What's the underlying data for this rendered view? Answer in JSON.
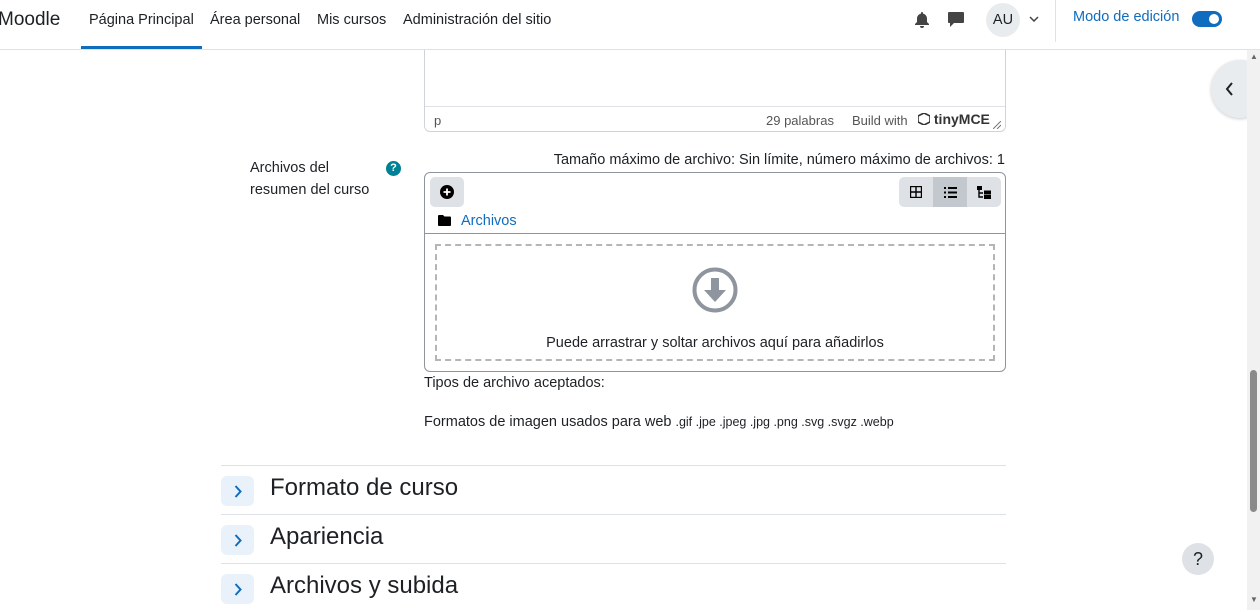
{
  "navbar": {
    "brand": "Moodle",
    "items": [
      {
        "label": "Página Principal",
        "active": true
      },
      {
        "label": "Área personal"
      },
      {
        "label": "Mis cursos"
      },
      {
        "label": "Administración del sitio"
      }
    ],
    "user_initials": "AU",
    "edit_mode_label": "Modo de edición",
    "edit_mode_on": true,
    "accent_color": "#0f6cbf"
  },
  "editor": {
    "path": "p",
    "word_count": "29 palabras",
    "build_with": "Build with",
    "editor_brand": "tinyMCE"
  },
  "filepicker": {
    "label": "Archivos del resumen del curso",
    "max_size_text": "Tamaño máximo de archivo: Sin límite, número máximo de archivos: 1",
    "folder_link": "Archivos",
    "dropzone_text": "Puede arrastrar y soltar archivos aquí para añadirlos",
    "accepted_types_label": "Tipos de archivo aceptados:",
    "formats_label": "Formatos de imagen usados para web",
    "formats_ext": ".gif .jpe .jpeg .jpg .png .svg .svgz .webp"
  },
  "sections": [
    {
      "title": "Formato de curso"
    },
    {
      "title": "Apariencia"
    },
    {
      "title": "Archivos y subida"
    }
  ],
  "help_fab": "?"
}
